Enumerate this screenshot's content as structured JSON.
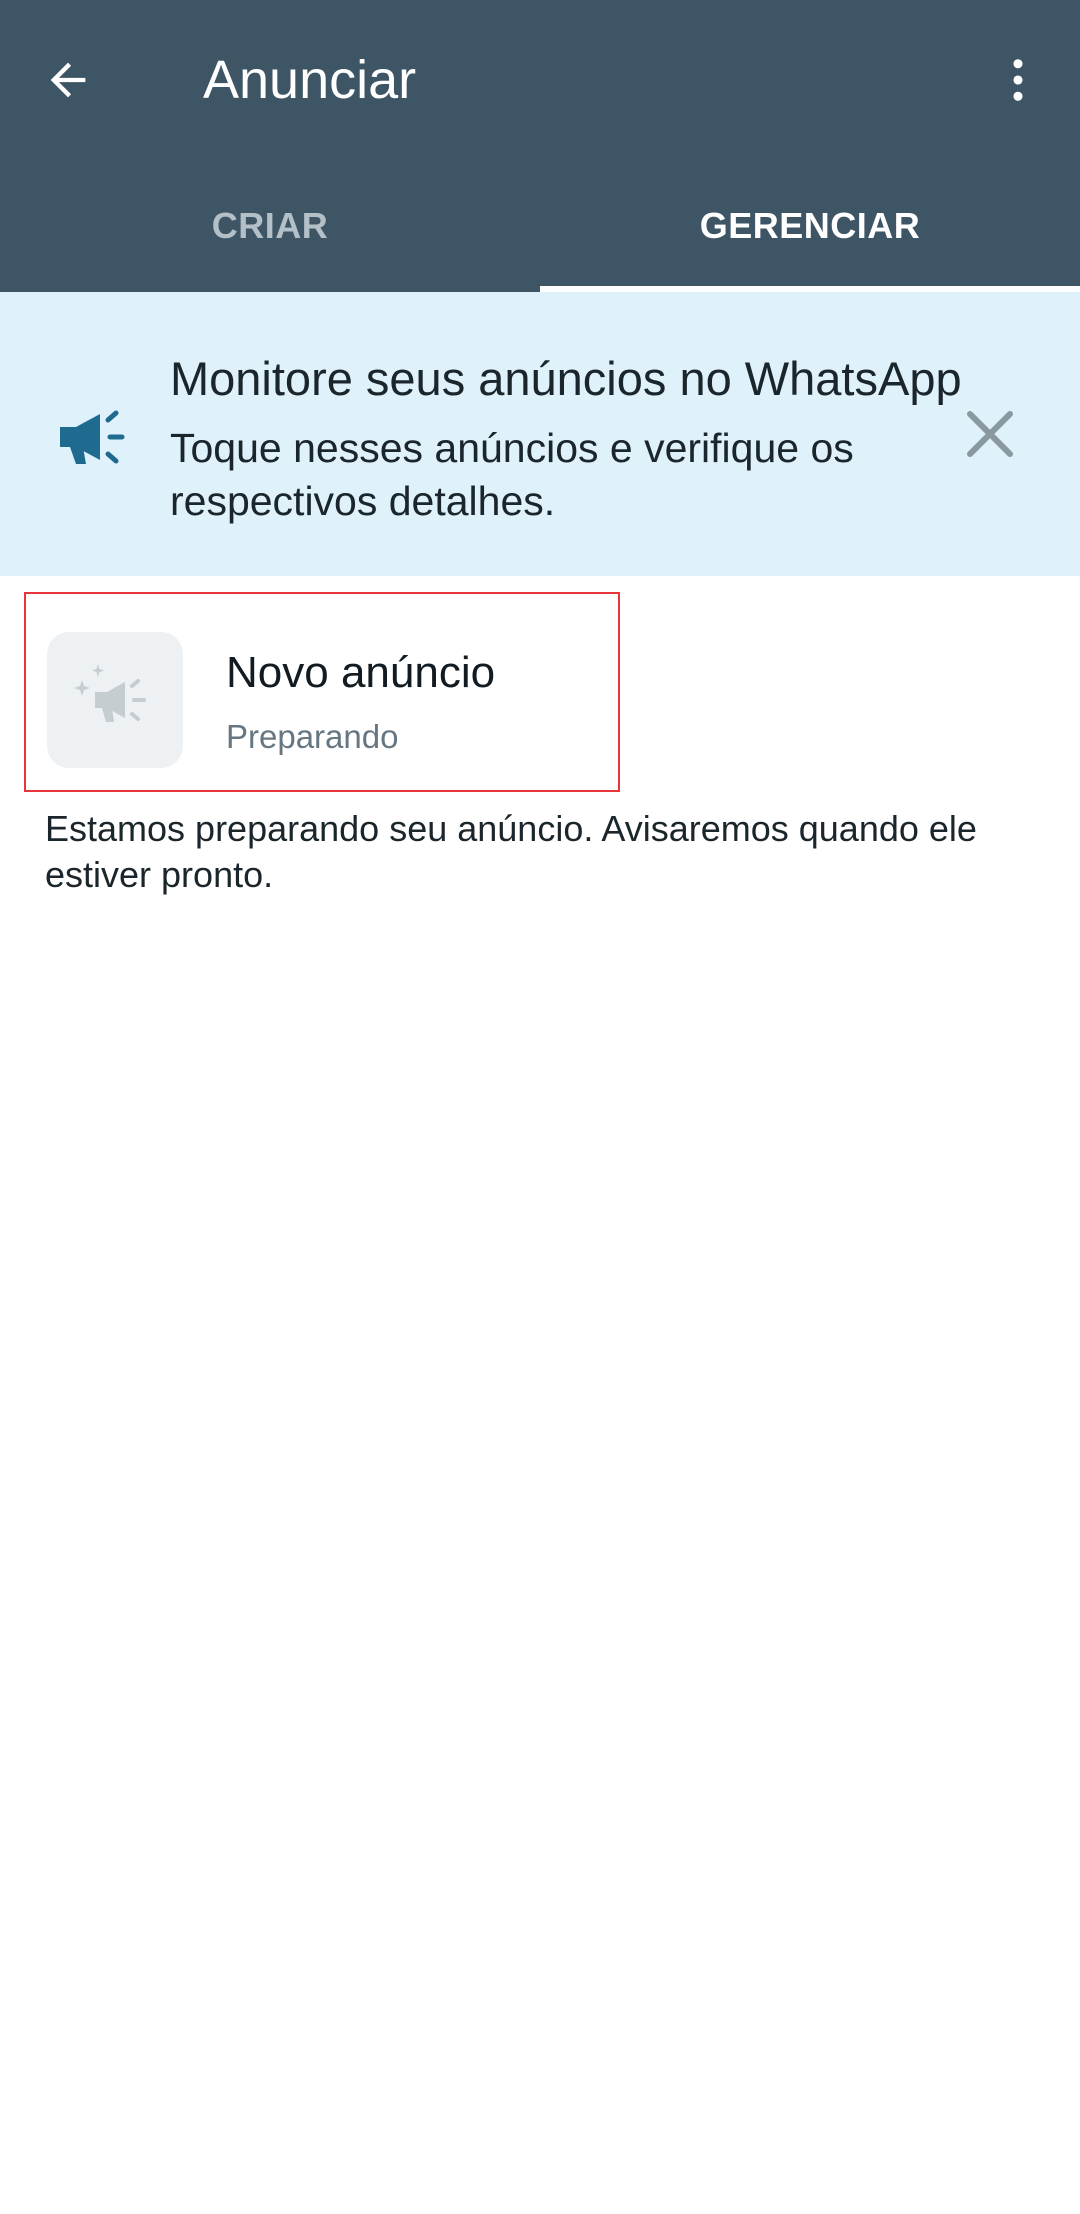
{
  "header": {
    "title": "Anunciar",
    "back_icon": "arrow-left-icon",
    "menu_icon": "more-vert-icon",
    "background_color": "#3d5565"
  },
  "tabs": [
    {
      "label": "CRIAR",
      "active": false
    },
    {
      "label": "GERENCIAR",
      "active": true
    }
  ],
  "banner": {
    "title": "Monitore seus anúncios no WhatsApp",
    "body": "Toque nesses anúncios e verifique os respectivos detalhes.",
    "icon": "megaphone-icon",
    "close_icon": "close-icon",
    "background_color": "#dff1fa",
    "icon_color": "#1e6b8f"
  },
  "ad_item": {
    "title": "Novo anúncio",
    "status": "Preparando",
    "thumb_icon": "megaphone-sparkle-icon"
  },
  "info_text": "Estamos preparando seu anúncio. Avisaremos quando ele estiver pronto."
}
